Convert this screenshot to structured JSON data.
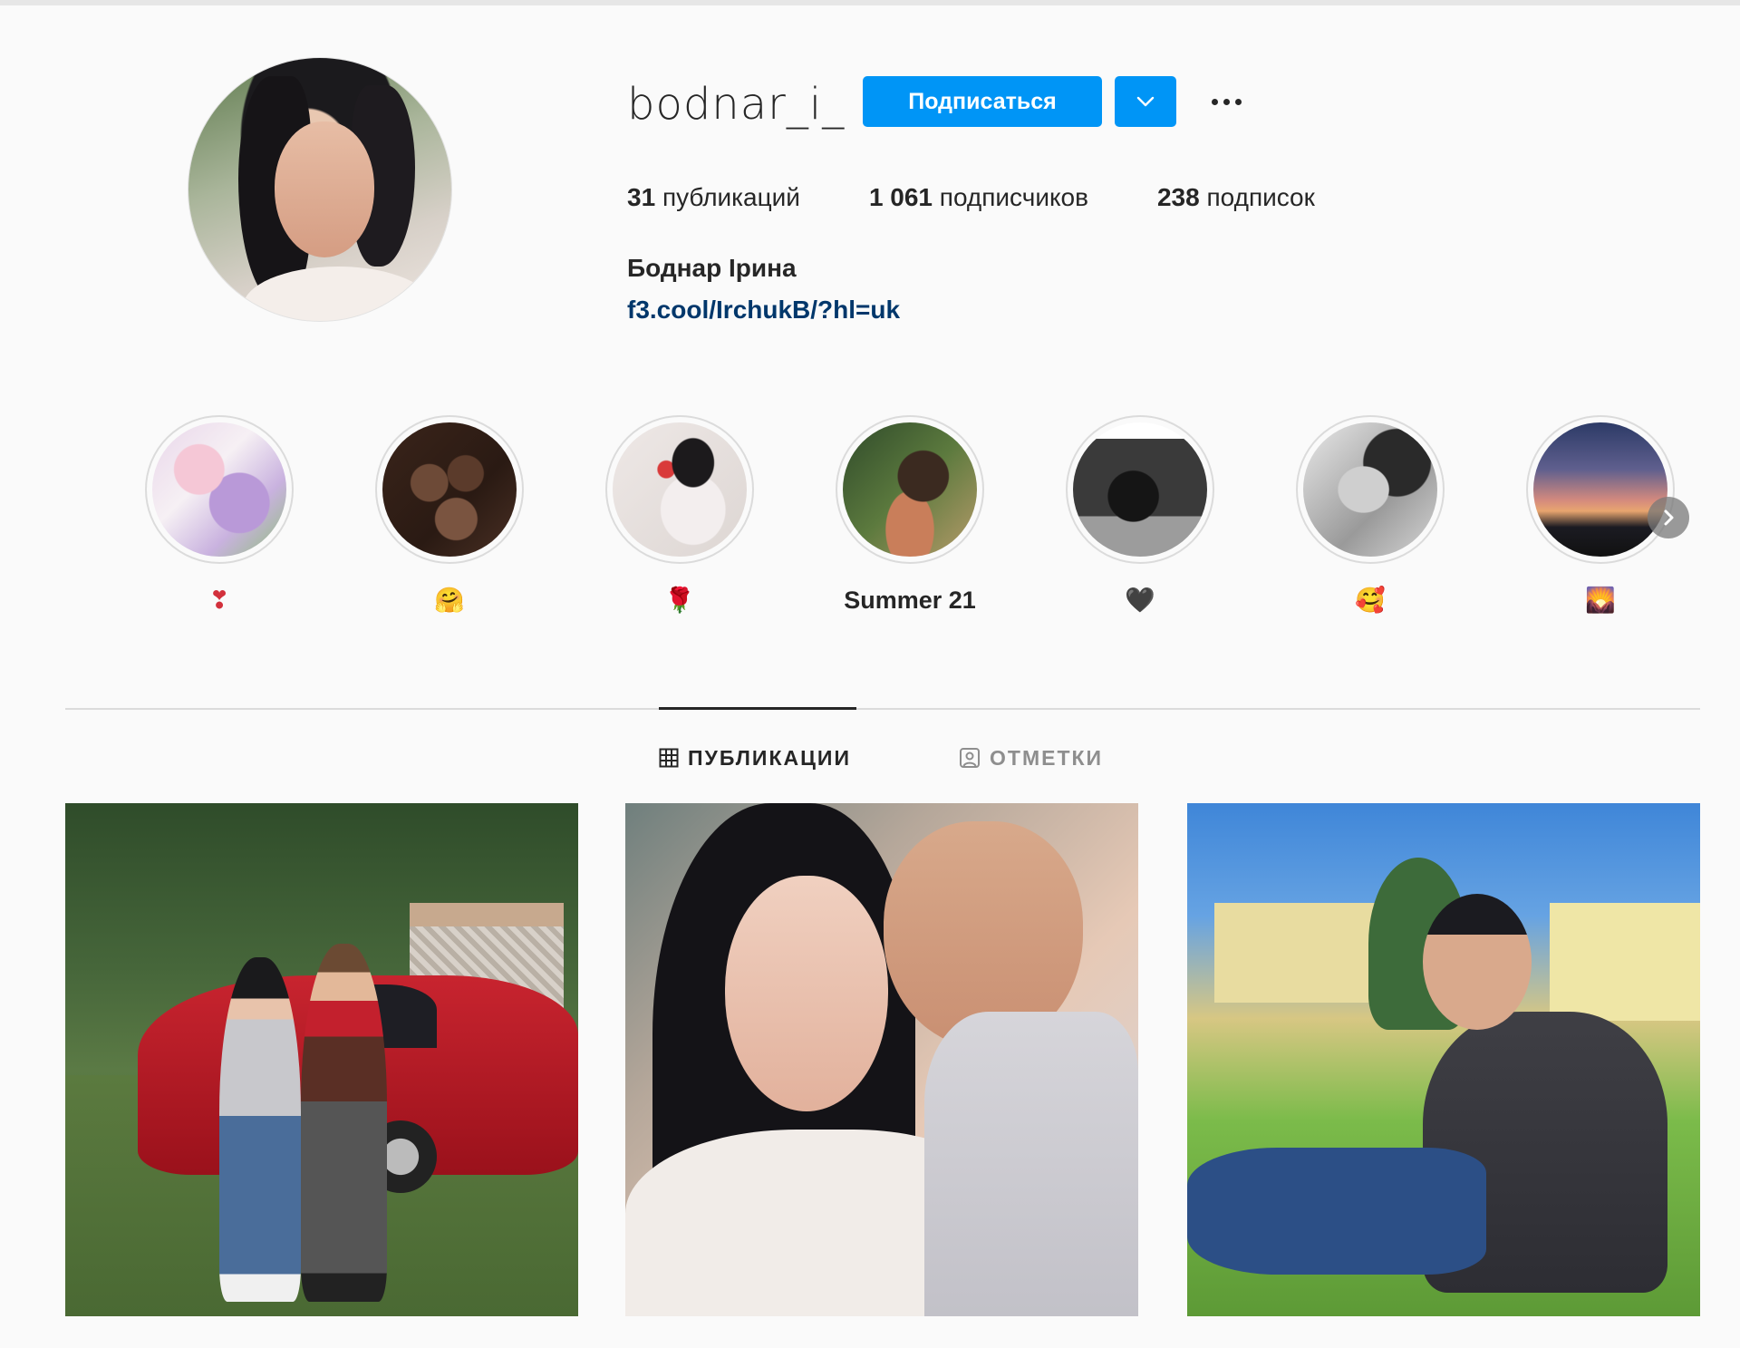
{
  "profile": {
    "username": "bodnar_i_",
    "follow_label": "Подписаться",
    "stats": {
      "posts_count": "31",
      "posts_label": "публикаций",
      "followers_count": "1 061",
      "followers_label": "подписчиков",
      "following_count": "238",
      "following_label": "подписок"
    },
    "full_name": "Боднар Ірина",
    "link": "f3.cool/IrchukB/?hl=uk"
  },
  "highlights": [
    {
      "label": "❣",
      "icon": "heart-exclamation-emoji",
      "color": "#d2303c"
    },
    {
      "label": "🤗",
      "icon": "hugging-face-emoji",
      "color": "#f2b53b"
    },
    {
      "label": "🌹",
      "icon": "rose-emoji",
      "color": "#c0252f"
    },
    {
      "label": "Summer 21",
      "icon": "",
      "color": ""
    },
    {
      "label": "🖤",
      "icon": "black-heart-emoji",
      "color": "#262626"
    },
    {
      "label": "🥰",
      "icon": "smiling-face-hearts-emoji",
      "color": "#f2a33a"
    },
    {
      "label": "🌄",
      "icon": "sunrise-mountains-emoji",
      "color": "#3aa0d8"
    }
  ],
  "tabs": {
    "posts": "ПУБЛИКАЦИИ",
    "tagged": "ОТМЕТКИ"
  },
  "theme": {
    "accent": "#0095f6",
    "link": "#00376b",
    "muted": "#8e8e8e"
  }
}
